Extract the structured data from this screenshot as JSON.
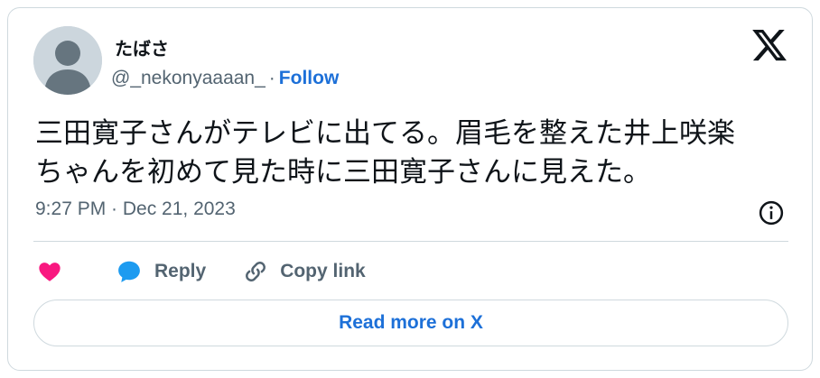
{
  "user": {
    "display_name": "たばさ",
    "handle": "@_nekonyaaaan_",
    "separator": "·",
    "follow_label": "Follow"
  },
  "tweet": {
    "text_line1": "三田寛子さんがテレビに出てる。眉毛を整えた井上咲楽",
    "text_line2": "ちゃんを初めて見た時に三田寛子さんに見えた。",
    "timestamp": "9:27 PM · Dec 21, 2023"
  },
  "actions": {
    "like_icon": "heart-icon",
    "reply_label": "Reply",
    "reply_icon": "speech-bubble-icon",
    "copy_link_label": "Copy link",
    "copy_link_icon": "link-icon"
  },
  "read_more_label": "Read more on X",
  "colors": {
    "accent": "#1d70d8",
    "heart": "#f91880",
    "reply": "#1d9bf0",
    "muted": "#536471",
    "border": "#cfd9de"
  }
}
